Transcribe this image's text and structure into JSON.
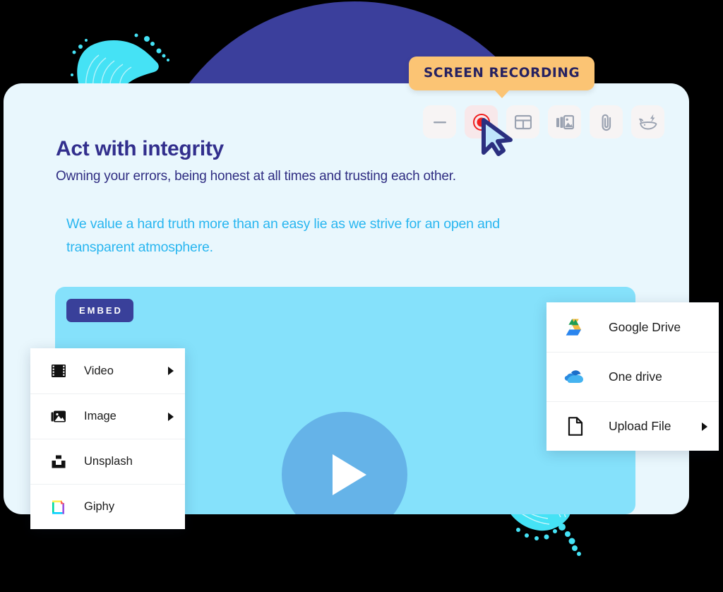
{
  "colors": {
    "page_background": "#000000",
    "deco_circle": "#3b3f9c",
    "deco_blob": "#45e2f5",
    "card_background": "#e9f7fd",
    "tooltip_background": "#fbc474",
    "tooltip_text": "#262261",
    "heading": "#322f8d",
    "subheading": "#2f2d82",
    "quote": "#29b6f0",
    "embed_background": "#85e1fb",
    "embed_badge": "#39409a",
    "play_circle": "#65b3e8",
    "record_dot": "#f01f1f",
    "cursor_fill": "#bfe6fb",
    "cursor_outline": "#2b2f7f",
    "toolbar_button": "#f7f4f4",
    "toolbar_button_active": "#f8e8ea"
  },
  "tooltip": {
    "label": "SCREEN RECORDING",
    "icon": "tooltip-pointer"
  },
  "toolbar": {
    "buttons": [
      {
        "name": "divider-button",
        "icon": "minus-icon",
        "label": "Divider",
        "active": false
      },
      {
        "name": "screen-recording-button",
        "icon": "record-icon",
        "label": "Screen recording",
        "active": true
      },
      {
        "name": "table-button",
        "icon": "table-icon",
        "label": "Table",
        "active": false
      },
      {
        "name": "gallery-button",
        "icon": "gallery-icon",
        "label": "Gallery",
        "active": false
      },
      {
        "name": "attachment-button",
        "icon": "paperclip-icon",
        "label": "Attachment",
        "active": false
      },
      {
        "name": "whale-button",
        "icon": "whale-bolt-icon",
        "label": "Integration",
        "active": false
      }
    ]
  },
  "content": {
    "heading": "Act with integrity",
    "subheading": "Owning your errors, being honest at all times and trusting each other.",
    "quote": "We value a hard truth more than an easy lie as we strive for an open and transparent atmosphere."
  },
  "embed": {
    "badge": "EMBED",
    "play_label": "Play",
    "play_icon": "play-icon"
  },
  "menu_left": {
    "items": [
      {
        "label": "Video",
        "icon": "film-icon",
        "has_submenu": true
      },
      {
        "label": "Image",
        "icon": "image-icon",
        "has_submenu": true
      },
      {
        "label": "Unsplash",
        "icon": "unsplash-icon",
        "has_submenu": false
      },
      {
        "label": "Giphy",
        "icon": "giphy-icon",
        "has_submenu": false
      }
    ]
  },
  "menu_right": {
    "items": [
      {
        "label": "Google Drive",
        "icon": "google-drive-icon",
        "has_submenu": false
      },
      {
        "label": "One drive",
        "icon": "onedrive-icon",
        "has_submenu": false
      },
      {
        "label": "Upload File",
        "icon": "file-icon",
        "has_submenu": true
      }
    ]
  }
}
